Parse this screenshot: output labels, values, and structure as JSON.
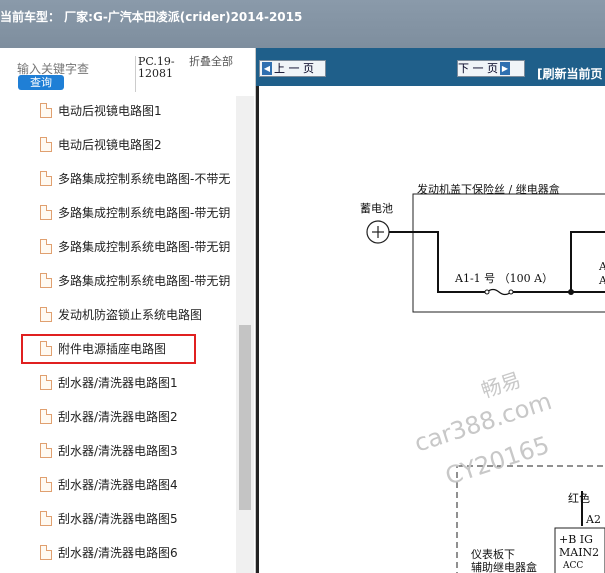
{
  "header": {
    "title": "当前车型： 厂家:G-广汽本田凌派(crider)2014-2015"
  },
  "search": {
    "placeholder": "输入关键字查",
    "query_label": "查询",
    "pc_code": "PC.19-12081",
    "fold_label": "折叠全部"
  },
  "tree": {
    "items": [
      "电动后视镜电路图1",
      "电动后视镜电路图2",
      "多路集成控制系统电路图-不带无",
      "多路集成控制系统电路图-带无钥",
      "多路集成控制系统电路图-带无钥",
      "多路集成控制系统电路图-带无钥",
      "发动机防盗锁止系统电路图",
      "附件电源插座电路图",
      "刮水器/清洗器电路图1",
      "刮水器/清洗器电路图2",
      "刮水器/清洗器电路图3",
      "刮水器/清洗器电路图4",
      "刮水器/清洗器电路图5",
      "刮水器/清洗器电路图6"
    ],
    "selected_index": 7
  },
  "toolbar": {
    "prev_label": "上 一 页",
    "next_label": "下 一 页",
    "refresh_label": "[刷新当前页"
  },
  "diagram": {
    "fuse_box_title": "发动机盖下保险丝 / 继电器盒",
    "battery_label": "蓄电池",
    "fuse_label": "A1-1 号 （100 A）",
    "right_label_a": "A",
    "right_label_a2": "A",
    "wire_color": "红色",
    "connector_a2": "A2",
    "module_line1": "+B  IG",
    "module_line2": "MAIN2",
    "module_line3": "ACC",
    "sub_box_line1": "仪表板下",
    "sub_box_line2": "辅助继电器盒"
  },
  "watermark": {
    "line1": "畅易",
    "line2": "car388.com",
    "line3": "CY20165"
  }
}
